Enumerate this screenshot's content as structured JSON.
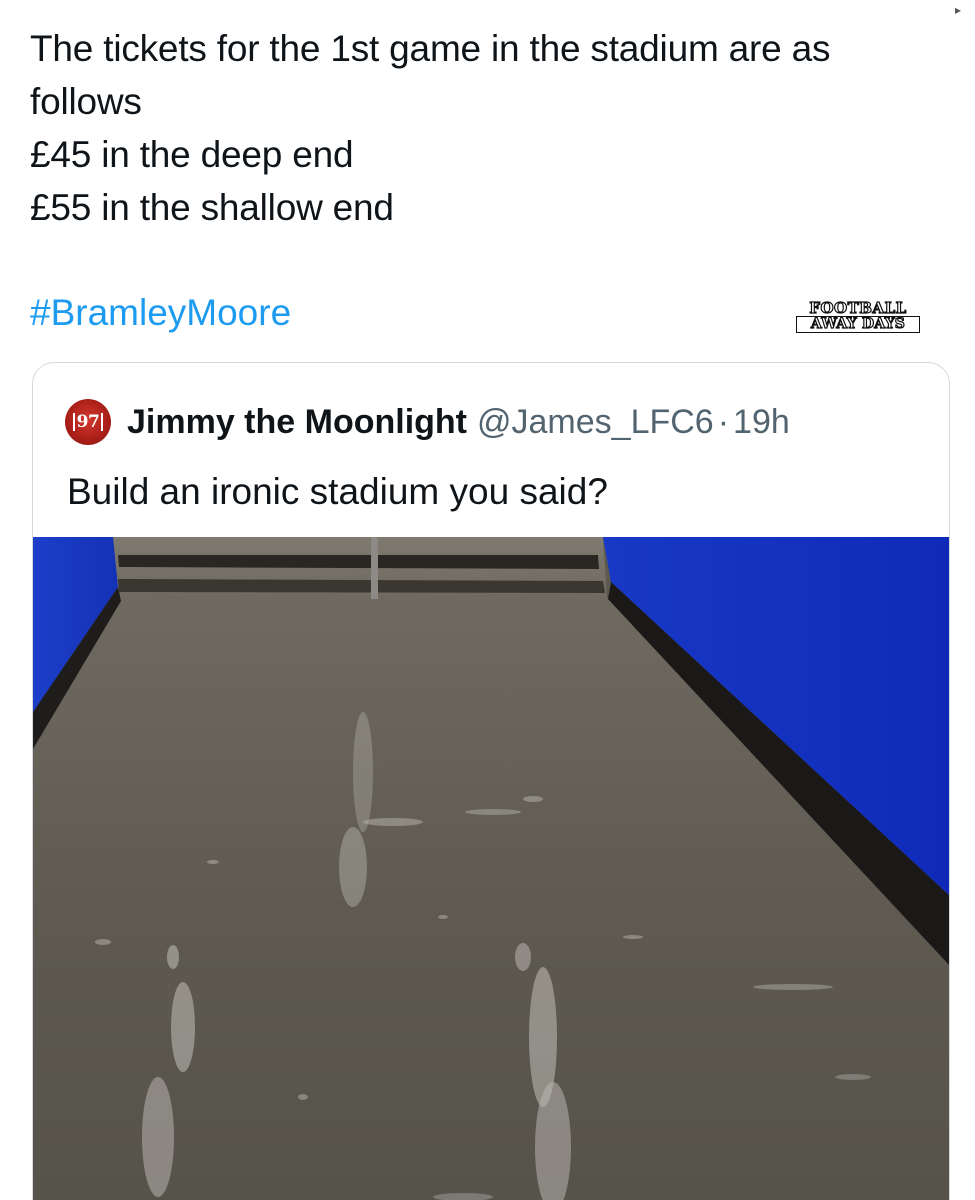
{
  "tweet": {
    "lines": [
      "The tickets for the 1st game in the stadium are as",
      "follows",
      "£45 in the deep end",
      "£55 in the shallow end"
    ],
    "hashtag": "#BramleyMoore"
  },
  "watermark": {
    "line1": "FOOTBALL",
    "line2": "AWAY DAYS"
  },
  "quote": {
    "avatar_text": "97",
    "author_name": "Jimmy the Moonlight",
    "handle": "@James_LFC6",
    "separator": "·",
    "time": "19h",
    "text": "Build an ironic stadium you said?"
  },
  "corner_glyph": "▸",
  "colors": {
    "link": "#1d9bf0",
    "text_primary": "#0f1419",
    "text_secondary": "#536471",
    "avatar_red": "#b5231c",
    "wall_blue": "#1537c8",
    "floor_grey": "#5f5b52"
  },
  "icons": {
    "avatar": "club-crest-avatar",
    "media": "flooded-concourse-photo"
  }
}
